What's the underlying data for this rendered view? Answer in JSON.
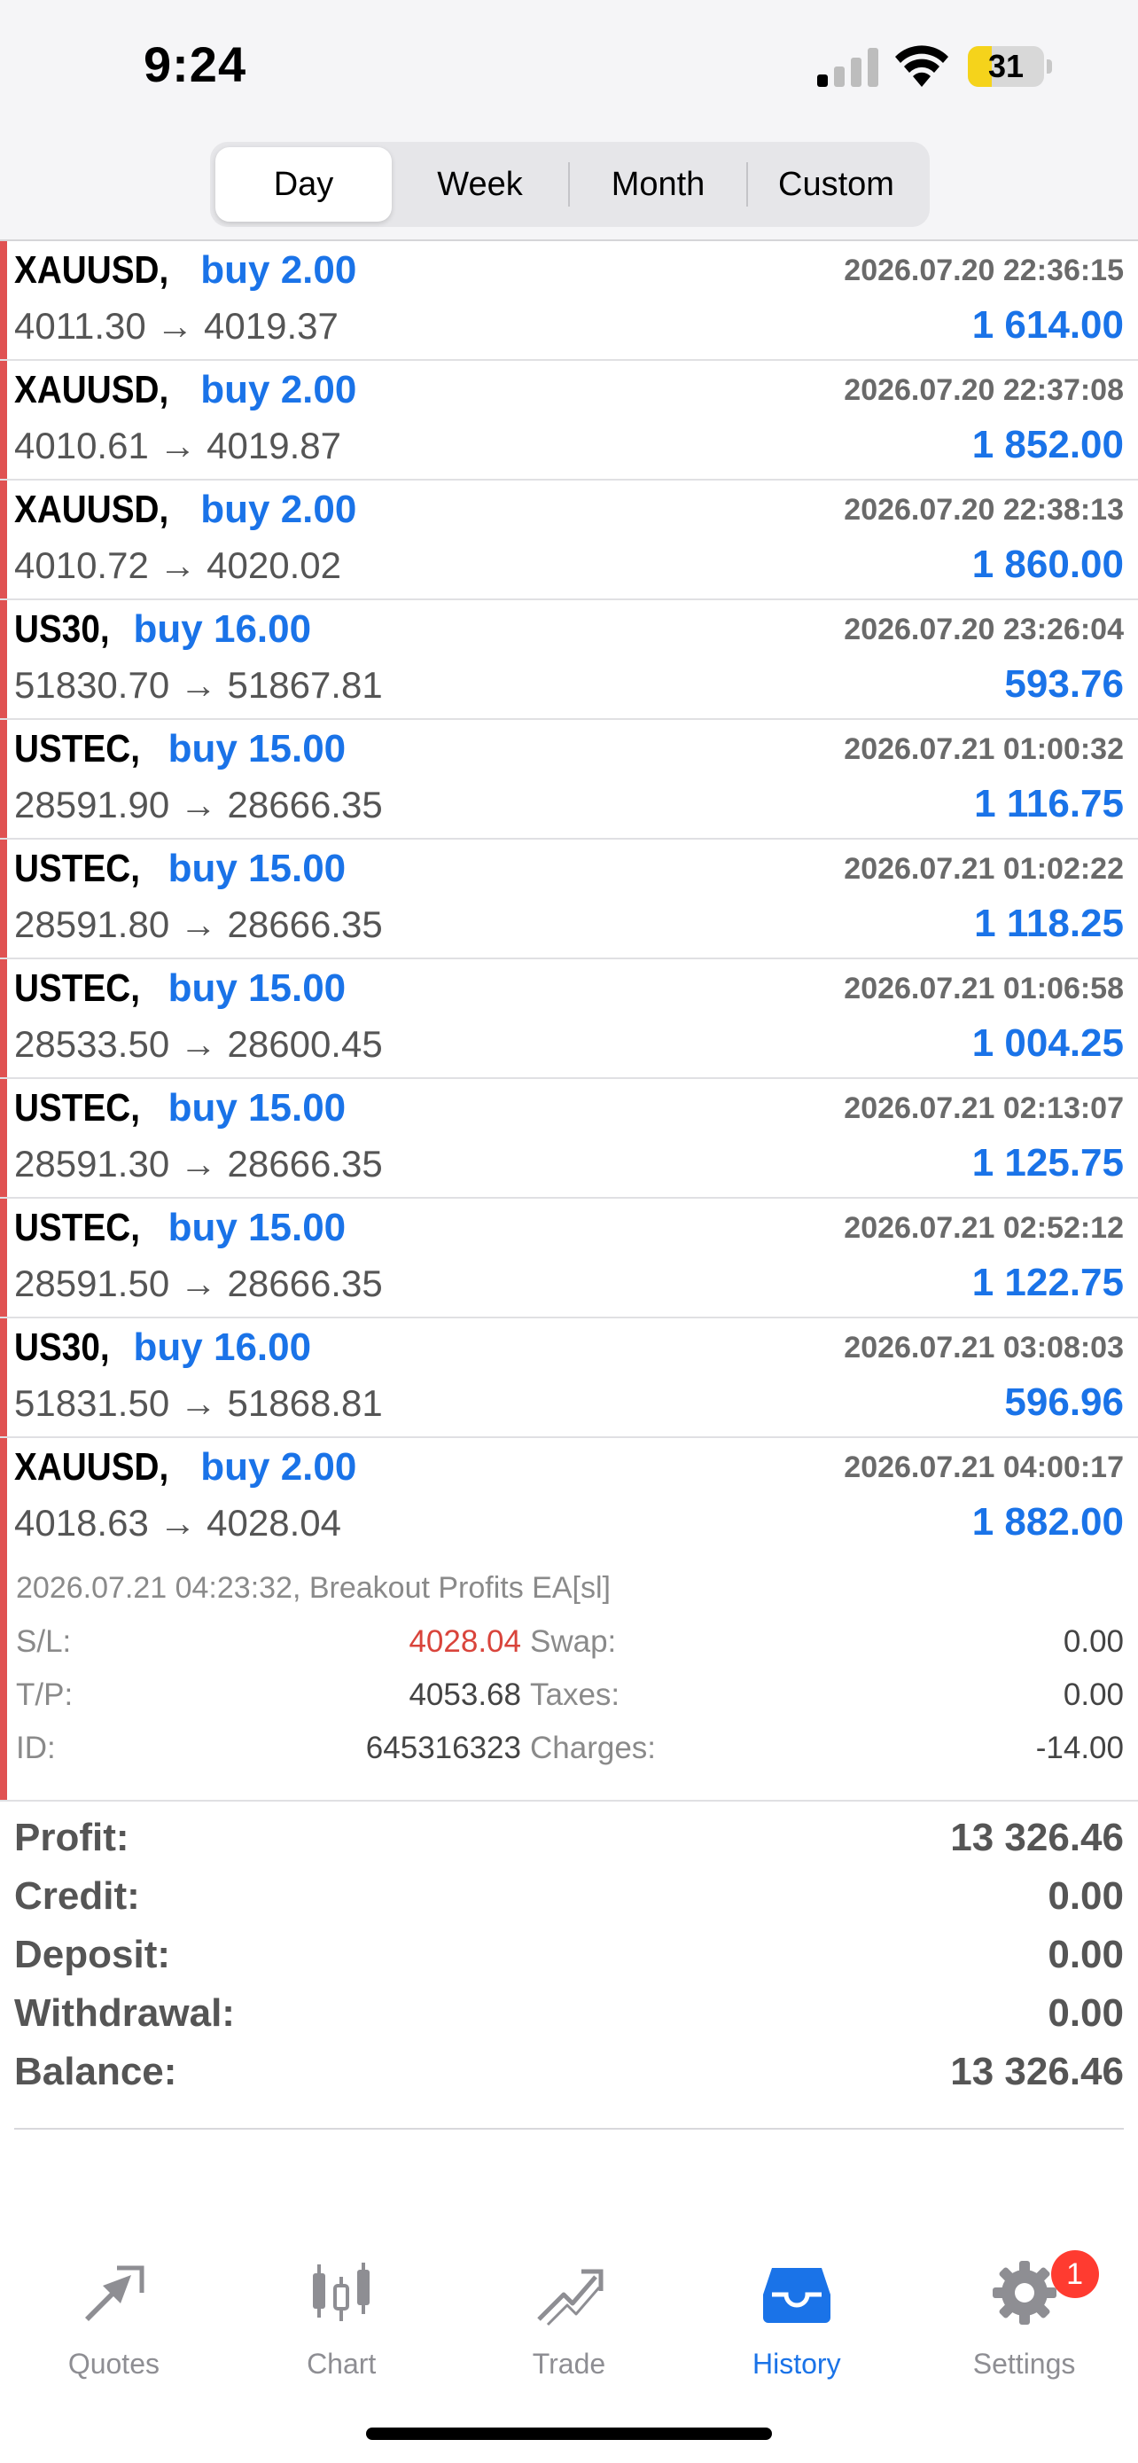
{
  "status": {
    "time": "9:24",
    "battery": "31",
    "battery_level": 0.31
  },
  "segments": [
    {
      "label": "Day",
      "active": true
    },
    {
      "label": "Week",
      "active": false
    },
    {
      "label": "Month",
      "active": false
    },
    {
      "label": "Custom",
      "active": false
    }
  ],
  "deals": [
    {
      "symbol": "XAUUSD,",
      "direction": "buy 2.00",
      "time": "2026.07.20 22:36:15",
      "prices": "4011.30 → 4019.37",
      "profit": "1 614.00"
    },
    {
      "symbol": "XAUUSD,",
      "direction": "buy 2.00",
      "time": "2026.07.20 22:37:08",
      "prices": "4010.61 → 4019.87",
      "profit": "1 852.00"
    },
    {
      "symbol": "XAUUSD,",
      "direction": "buy 2.00",
      "time": "2026.07.20 22:38:13",
      "prices": "4010.72 → 4020.02",
      "profit": "1 860.00"
    },
    {
      "symbol": "US30,",
      "direction": "buy 16.00",
      "time": "2026.07.20 23:26:04",
      "prices": "51830.70 → 51867.81",
      "profit": "593.76"
    },
    {
      "symbol": "USTEC,",
      "direction": "buy 15.00",
      "time": "2026.07.21 01:00:32",
      "prices": "28591.90 → 28666.35",
      "profit": "1 116.75"
    },
    {
      "symbol": "USTEC,",
      "direction": "buy 15.00",
      "time": "2026.07.21 01:02:22",
      "prices": "28591.80 → 28666.35",
      "profit": "1 118.25"
    },
    {
      "symbol": "USTEC,",
      "direction": "buy 15.00",
      "time": "2026.07.21 01:06:58",
      "prices": "28533.50 → 28600.45",
      "profit": "1 004.25"
    },
    {
      "symbol": "USTEC,",
      "direction": "buy 15.00",
      "time": "2026.07.21 02:13:07",
      "prices": "28591.30 → 28666.35",
      "profit": "1 125.75"
    },
    {
      "symbol": "USTEC,",
      "direction": "buy 15.00",
      "time": "2026.07.21 02:52:12",
      "prices": "28591.50 → 28666.35",
      "profit": "1 122.75"
    },
    {
      "symbol": "US30,",
      "direction": "buy 16.00",
      "time": "2026.07.21 03:08:03",
      "prices": "51831.50 → 51868.81",
      "profit": "596.96"
    }
  ],
  "expanded_deal": {
    "symbol": "XAUUSD,",
    "direction": "buy 2.00",
    "time": "2026.07.21 04:00:17",
    "prices": "4018.63 → 4028.04",
    "profit": "1 882.00",
    "comment": "2026.07.21 04:23:32, Breakout Profits EA[sl]",
    "sl_label": "S/L:",
    "sl": "4028.04",
    "tp_label": "T/P:",
    "tp": "4053.68",
    "id_label": "ID:",
    "id": "645316323",
    "swap_label": "Swap:",
    "swap": "0.00",
    "taxes_label": "Taxes:",
    "taxes": "0.00",
    "charges_label": "Charges:",
    "charges": "-14.00"
  },
  "summary": [
    {
      "label": "Profit:",
      "value": "13 326.46"
    },
    {
      "label": "Credit:",
      "value": "0.00"
    },
    {
      "label": "Deposit:",
      "value": "0.00"
    },
    {
      "label": "Withdrawal:",
      "value": "0.00"
    },
    {
      "label": "Balance:",
      "value": "13 326.46"
    }
  ],
  "tabs": [
    {
      "label": "Quotes",
      "icon": "quotes-icon"
    },
    {
      "label": "Chart",
      "icon": "chart-icon"
    },
    {
      "label": "Trade",
      "icon": "trade-icon"
    },
    {
      "label": "History",
      "icon": "history-icon",
      "active": true
    },
    {
      "label": "Settings",
      "icon": "gear-icon",
      "badge": "1"
    }
  ],
  "colors": {
    "accent": "#1a73e8",
    "loss_bar": "#e05252",
    "sl_red": "#d9443b",
    "badge": "#ff3b30"
  }
}
